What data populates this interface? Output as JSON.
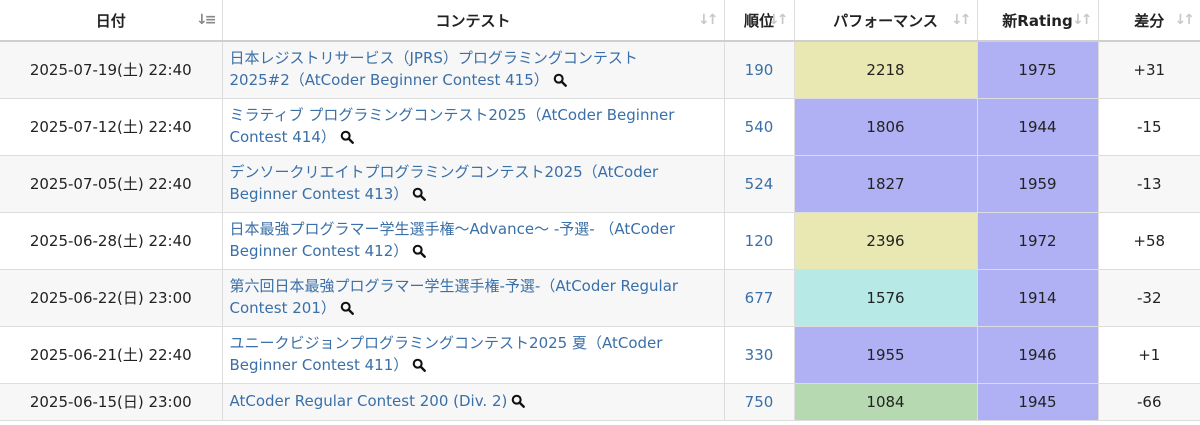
{
  "headers": {
    "date": "日付",
    "contest": "コンテスト",
    "rank": "順位",
    "performance": "パフォーマンス",
    "new_rating": "新Rating",
    "diff": "差分"
  },
  "colors": {
    "link": "#3a6fa8",
    "perf_yellow": "#e9e8b3",
    "perf_blue": "#b0b0f5",
    "perf_cyan": "#b7e9e6",
    "perf_green": "#b6d9b1",
    "rating_blue": "#b0b0f5"
  },
  "rows": [
    {
      "date": "2025-07-19(土) 22:40",
      "contest_line1": "日本レジストリサービス（JPRS）プログラミングコンテスト",
      "contest_line2": "2025#2（AtCoder Beginner Contest 415）",
      "rank": "190",
      "performance": "2218",
      "perf_color": "#e9e8b3",
      "new_rating": "1975",
      "diff": "+31"
    },
    {
      "date": "2025-07-12(土) 22:40",
      "contest_line1": "ミラティブ プログラミングコンテスト2025（AtCoder Beginner",
      "contest_line2": "Contest 414）",
      "rank": "540",
      "performance": "1806",
      "perf_color": "#b0b0f5",
      "new_rating": "1944",
      "diff": "-15"
    },
    {
      "date": "2025-07-05(土) 22:40",
      "contest_line1": "デンソークリエイトプログラミングコンテスト2025（AtCoder",
      "contest_line2": "Beginner Contest 413）",
      "rank": "524",
      "performance": "1827",
      "perf_color": "#b0b0f5",
      "new_rating": "1959",
      "diff": "-13"
    },
    {
      "date": "2025-06-28(土) 22:40",
      "contest_line1": "日本最強プログラマー学生選手権〜Advance〜 -予選- （AtCoder",
      "contest_line2": "Beginner Contest 412）",
      "rank": "120",
      "performance": "2396",
      "perf_color": "#e9e8b3",
      "new_rating": "1972",
      "diff": "+58"
    },
    {
      "date": "2025-06-22(日) 23:00",
      "contest_line1": "第六回日本最強プログラマー学生選手権-予選-（AtCoder Regular",
      "contest_line2": "Contest 201）",
      "rank": "677",
      "performance": "1576",
      "perf_color": "#b7e9e6",
      "new_rating": "1914",
      "diff": "-32"
    },
    {
      "date": "2025-06-21(土) 22:40",
      "contest_line1": "ユニークビジョンプログラミングコンテスト2025 夏（AtCoder",
      "contest_line2": "Beginner Contest 411）",
      "rank": "330",
      "performance": "1955",
      "perf_color": "#b0b0f5",
      "new_rating": "1946",
      "diff": "+1"
    },
    {
      "date": "2025-06-15(日) 23:00",
      "contest_line1": "AtCoder Regular Contest 200 (Div. 2)",
      "contest_line2": "",
      "rank": "750",
      "performance": "1084",
      "perf_color": "#b6d9b1",
      "new_rating": "1945",
      "diff": "-66"
    }
  ]
}
